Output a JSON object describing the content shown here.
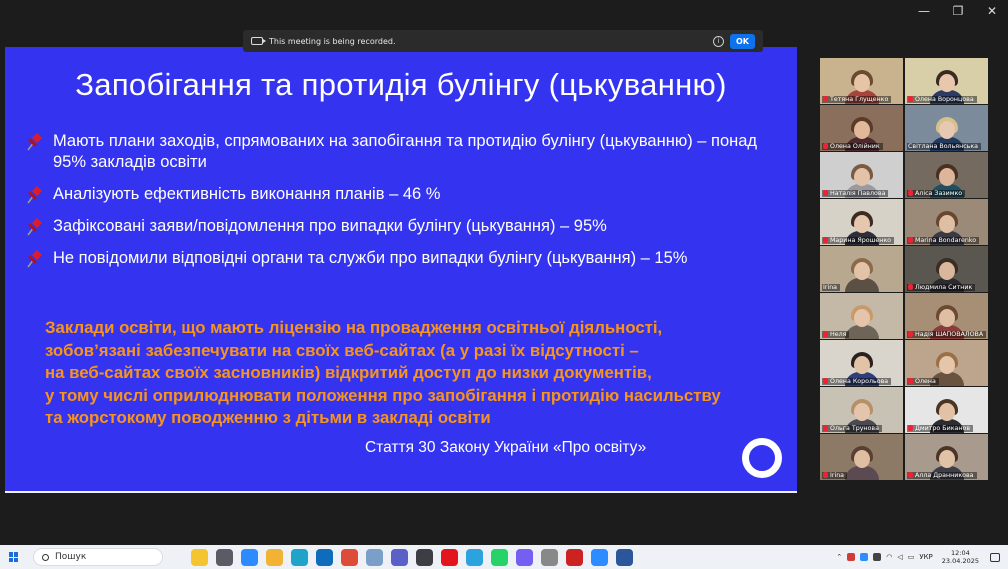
{
  "window": {
    "controls": [
      "—",
      "❐",
      "✕"
    ]
  },
  "recording_banner": {
    "message": "This meeting is being recorded.",
    "ok_label": "OK"
  },
  "slide": {
    "title": "Запобігання та протидія булінгу (цькуванню)",
    "bullets": [
      "Мають плани заходів, спрямованих на запобігання та протидію булінгу (цькуванню) – понад 95% закладів освіти",
      "Аналізують ефективність виконання планів – 46 %",
      "Зафіксовані заяви/повідомлення  про випадки булінгу (цькування) – 95%",
      "Не повідомили відповідні органи та служби про випадки булінгу (цькування) – 15%"
    ],
    "highlight_lines": [
      "Заклади освіти, що мають ліцензію на провадження освітньої діяльності,",
      "зобов’язані забезпечувати на своїх веб-сайтах (а у разі їх відсутності –",
      "на веб-сайтах своїх засновників) відкритий доступ до низки документів,",
      "у тому числі оприлюднювати положення про запобігання і протидію насильству",
      "та жорстокому поводженню з дітьми в закладі освіти"
    ],
    "citation": "Стаття 30 Закону України «Про освіту»",
    "colors": {
      "background": "#3333f0",
      "text": "#ffffff",
      "highlight": "#f7941d"
    }
  },
  "participants": [
    {
      "name": "Тетяна Глущенко",
      "bg": "#c9b28e",
      "skin": "#e7c4a6",
      "hair": "#6b4a30",
      "shirt": "#a7453d",
      "muted": true
    },
    {
      "name": "Олена Воронцова",
      "bg": "#d8cfa8",
      "skin": "#e9c7ac",
      "hair": "#3a2a22",
      "shirt": "#2c3b63",
      "muted": true
    },
    {
      "name": "Олена Олійник",
      "bg": "#8a6f5c",
      "skin": "#e2b89a",
      "hair": "#5a3b2a",
      "shirt": "#4a2a2f",
      "muted": true
    },
    {
      "name": "Світлана Вольянська",
      "bg": "#7c8b9c",
      "skin": "#e6c8b3",
      "hair": "#d7c08a",
      "shirt": "#223a5e",
      "muted": false,
      "active": true
    },
    {
      "name": "Наталія Павлова",
      "bg": "#cfcfcf",
      "skin": "#e2c2a8",
      "hair": "#7a5a40",
      "shirt": "#9a9aa0",
      "muted": true
    },
    {
      "name": "Аліса Зазимко",
      "bg": "#756a60",
      "skin": "#dcb59a",
      "hair": "#4a2f22",
      "shirt": "#1f4f60",
      "muted": true
    },
    {
      "name": "Марина Ярошенко",
      "bg": "#d7d2c8",
      "skin": "#e7c6ae",
      "hair": "#3d2b22",
      "shirt": "#2f2f3a",
      "muted": true
    },
    {
      "name": "Marina Bondarenko",
      "bg": "#9c8a78",
      "skin": "#dfbfa3",
      "hair": "#6a4630",
      "shirt": "#3a3a44",
      "muted": true
    },
    {
      "name": "Irina",
      "bg": "#b8a890",
      "skin": "#e3c3a8",
      "hair": "#8a6a48",
      "shirt": "#5c5044",
      "muted": false
    },
    {
      "name": "Людмила Ситник",
      "bg": "#5a5750",
      "skin": "#d9b79c",
      "hair": "#3b2c24",
      "shirt": "#2b2b30",
      "muted": true
    },
    {
      "name": "Неля",
      "bg": "#c4b9a7",
      "skin": "#e4c4aa",
      "hair": "#c89a6a",
      "shirt": "#6e6458",
      "muted": true
    },
    {
      "name": "Надія ШАПОВАЛОВА",
      "bg": "#a68f74",
      "skin": "#e0bea3",
      "hair": "#6b4a32",
      "shirt": "#8a3c3a",
      "muted": true
    },
    {
      "name": "Олена Корольова",
      "bg": "#d9d4cc",
      "skin": "#e3c3a6",
      "hair": "#2a2020",
      "shirt": "#2e3e7a",
      "muted": true
    },
    {
      "name": "Олена",
      "bg": "#bca58c",
      "skin": "#e5c6ab",
      "hair": "#9b7048",
      "shirt": "#6a5240",
      "muted": true
    },
    {
      "name": "Ольга Трунова",
      "bg": "#c8c2b4",
      "skin": "#e4c5ab",
      "hair": "#b69068",
      "shirt": "#4a4a52",
      "muted": true
    },
    {
      "name": "Дмитро Биканов",
      "bg": "#e6e6e6",
      "skin": "#e3c1a4",
      "hair": "#4a3426",
      "shirt": "#2c2c34",
      "muted": true
    },
    {
      "name": "Irina",
      "bg": "#8c7a66",
      "skin": "#dfbea2",
      "hair": "#5a4030",
      "shirt": "#5b4a52",
      "muted": true
    },
    {
      "name": "Алла Дранникова",
      "bg": "#a89b8e",
      "skin": "#e2c2a6",
      "hair": "#4b3428",
      "shirt": "#3e3e46",
      "muted": true
    }
  ],
  "taskbar": {
    "search_label": "Пошук",
    "apps": [
      {
        "name": "widgets-icon",
        "color": "#f4c431"
      },
      {
        "name": "task-view-icon",
        "color": "#5b5b66"
      },
      {
        "name": "copilot-icon",
        "color": "#2e8bff"
      },
      {
        "name": "file-explorer-icon",
        "color": "#f2b233"
      },
      {
        "name": "edge-icon",
        "color": "#1fa3c8"
      },
      {
        "name": "outlook-icon",
        "color": "#0f6cbd"
      },
      {
        "name": "chrome-icon",
        "color": "#dd4b39"
      },
      {
        "name": "notepad-icon",
        "color": "#7a9fc9"
      },
      {
        "name": "teams-icon",
        "color": "#5b5fc7"
      },
      {
        "name": "calculator-icon",
        "color": "#3d3d45"
      },
      {
        "name": "opera-icon",
        "color": "#e3141c"
      },
      {
        "name": "telegram-icon",
        "color": "#2aa3de"
      },
      {
        "name": "whatsapp-icon",
        "color": "#25d366"
      },
      {
        "name": "viber-icon",
        "color": "#7360f2"
      },
      {
        "name": "photos-icon",
        "color": "#888888"
      },
      {
        "name": "red-app-icon",
        "color": "#cc2222"
      },
      {
        "name": "zoom-icon",
        "color": "#2d8cff"
      },
      {
        "name": "word-icon",
        "color": "#2b579a"
      }
    ],
    "tray": {
      "language": "УКР",
      "time": "12:04",
      "date": "23.04.2025"
    }
  }
}
